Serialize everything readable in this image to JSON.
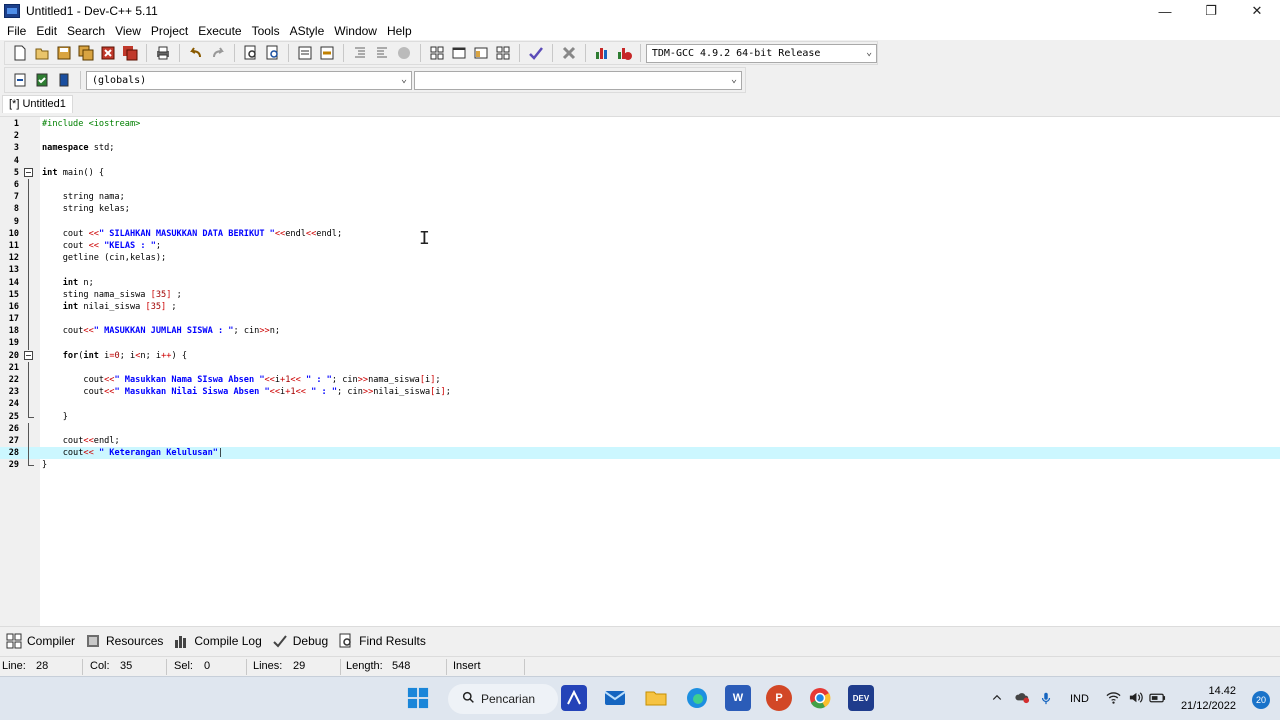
{
  "window": {
    "title": "Untitled1 - Dev-C++ 5.11",
    "controls": [
      "—",
      "❐",
      "✕"
    ]
  },
  "menu": [
    "File",
    "Edit",
    "Search",
    "View",
    "Project",
    "Execute",
    "Tools",
    "AStyle",
    "Window",
    "Help"
  ],
  "toolbar": {
    "compiler_select": "TDM-GCC 4.9.2 64-bit Release",
    "scope_select": "(globals)",
    "symbol_select": ""
  },
  "tab": {
    "label": "[*] Untitled1"
  },
  "editor": {
    "current_line": 28,
    "lines": [
      {
        "n": "1",
        "html": "<span class=\"pp\">#include &lt;iostream&gt;</span>"
      },
      {
        "n": "2",
        "html": ""
      },
      {
        "n": "3",
        "html": "<span class=\"kw\">namespace</span> std;"
      },
      {
        "n": "4",
        "html": ""
      },
      {
        "n": "5",
        "html": "<span class=\"kw\">int</span> main() {",
        "fold": "open"
      },
      {
        "n": "6",
        "html": "",
        "fold": "line"
      },
      {
        "n": "7",
        "html": "    string nama;",
        "fold": "line"
      },
      {
        "n": "8",
        "html": "    string kelas;",
        "fold": "line"
      },
      {
        "n": "9",
        "html": "",
        "fold": "line"
      },
      {
        "n": "10",
        "html": "    cout <span class=\"op\">&lt;&lt;</span><span class=\"str\">\" SILAHKAN MASUKKAN DATA BERIKUT \"</span><span class=\"op\">&lt;&lt;</span>endl<span class=\"op\">&lt;&lt;</span>endl;",
        "fold": "line"
      },
      {
        "n": "11",
        "html": "    cout <span class=\"op\">&lt;&lt;</span> <span class=\"str\">\"KELAS : \"</span>;",
        "fold": "line"
      },
      {
        "n": "12",
        "html": "    getline (cin,kelas);",
        "fold": "line"
      },
      {
        "n": "13",
        "html": "",
        "fold": "line"
      },
      {
        "n": "14",
        "html": "    <span class=\"kw\">int</span> n;",
        "fold": "line"
      },
      {
        "n": "15",
        "html": "    sting nama_siswa <span class=\"op\">[</span><span class=\"num\">35</span><span class=\"op\">]</span> ;",
        "fold": "line"
      },
      {
        "n": "16",
        "html": "    <span class=\"kw\">int</span> nilai_siswa <span class=\"op\">[</span><span class=\"num\">35</span><span class=\"op\">]</span> ;",
        "fold": "line"
      },
      {
        "n": "17",
        "html": "",
        "fold": "line"
      },
      {
        "n": "18",
        "html": "    cout<span class=\"op\">&lt;&lt;</span><span class=\"str\">\" MASUKKAN JUMLAH SISWA : \"</span>; cin<span class=\"op\">&gt;&gt;</span>n;",
        "fold": "line"
      },
      {
        "n": "19",
        "html": "",
        "fold": "line"
      },
      {
        "n": "20",
        "html": "    <span class=\"kw\">for</span>(<span class=\"kw\">int</span> i<span class=\"op\">=</span><span class=\"num\">0</span>; i<span class=\"op\">&lt;</span>n; i<span class=\"op\">++</span>) {",
        "fold": "open"
      },
      {
        "n": "21",
        "html": "",
        "fold": "line"
      },
      {
        "n": "22",
        "html": "        cout<span class=\"op\">&lt;&lt;</span><span class=\"str\">\" Masukkan Nama SIswa Absen \"</span><span class=\"op\">&lt;&lt;</span>i<span class=\"op\">+</span><span class=\"num\">1</span><span class=\"op\">&lt;&lt;</span> <span class=\"str\">\" : \"</span>; cin<span class=\"op\">&gt;&gt;</span>nama_siswa<span class=\"op\">[</span>i<span class=\"op\">]</span>;",
        "fold": "line"
      },
      {
        "n": "23",
        "html": "        cout<span class=\"op\">&lt;&lt;</span><span class=\"str\">\" Masukkan Nilai Siswa Absen \"</span><span class=\"op\">&lt;&lt;</span>i<span class=\"op\">+</span><span class=\"num\">1</span><span class=\"op\">&lt;&lt;</span> <span class=\"str\">\" : \"</span>; cin<span class=\"op\">&gt;&gt;</span>nilai_siswa<span class=\"op\">[</span>i<span class=\"op\">]</span>;",
        "fold": "line"
      },
      {
        "n": "24",
        "html": "",
        "fold": "line"
      },
      {
        "n": "25",
        "html": "    }",
        "fold": "end"
      },
      {
        "n": "26",
        "html": "",
        "fold": "line"
      },
      {
        "n": "27",
        "html": "    cout<span class=\"op\">&lt;&lt;</span>endl;",
        "fold": "line"
      },
      {
        "n": "28",
        "html": "    cout<span class=\"op\">&lt;&lt;</span> <span class=\"str\">\" Keterangan Kelulusan\"</span>|",
        "fold": "line"
      },
      {
        "n": "29",
        "html": "}",
        "fold": "end"
      }
    ]
  },
  "bottom_tabs": [
    {
      "label": "Compiler",
      "icon": "compiler-icon"
    },
    {
      "label": "Resources",
      "icon": "resources-icon"
    },
    {
      "label": "Compile Log",
      "icon": "compile-log-icon"
    },
    {
      "label": "Debug",
      "icon": "debug-icon"
    },
    {
      "label": "Find Results",
      "icon": "find-results-icon"
    }
  ],
  "status": {
    "line_label": "Line:",
    "line_value": "28",
    "col_label": "Col:",
    "col_value": "35",
    "sel_label": "Sel:",
    "sel_value": "0",
    "lines_label": "Lines:",
    "lines_value": "29",
    "length_label": "Length:",
    "length_value": "548",
    "mode": "Insert"
  },
  "taskbar": {
    "search_label": "Pencarian",
    "lang": "IND",
    "time": "14.42",
    "date": "21/12/2022",
    "notifications": "20"
  }
}
